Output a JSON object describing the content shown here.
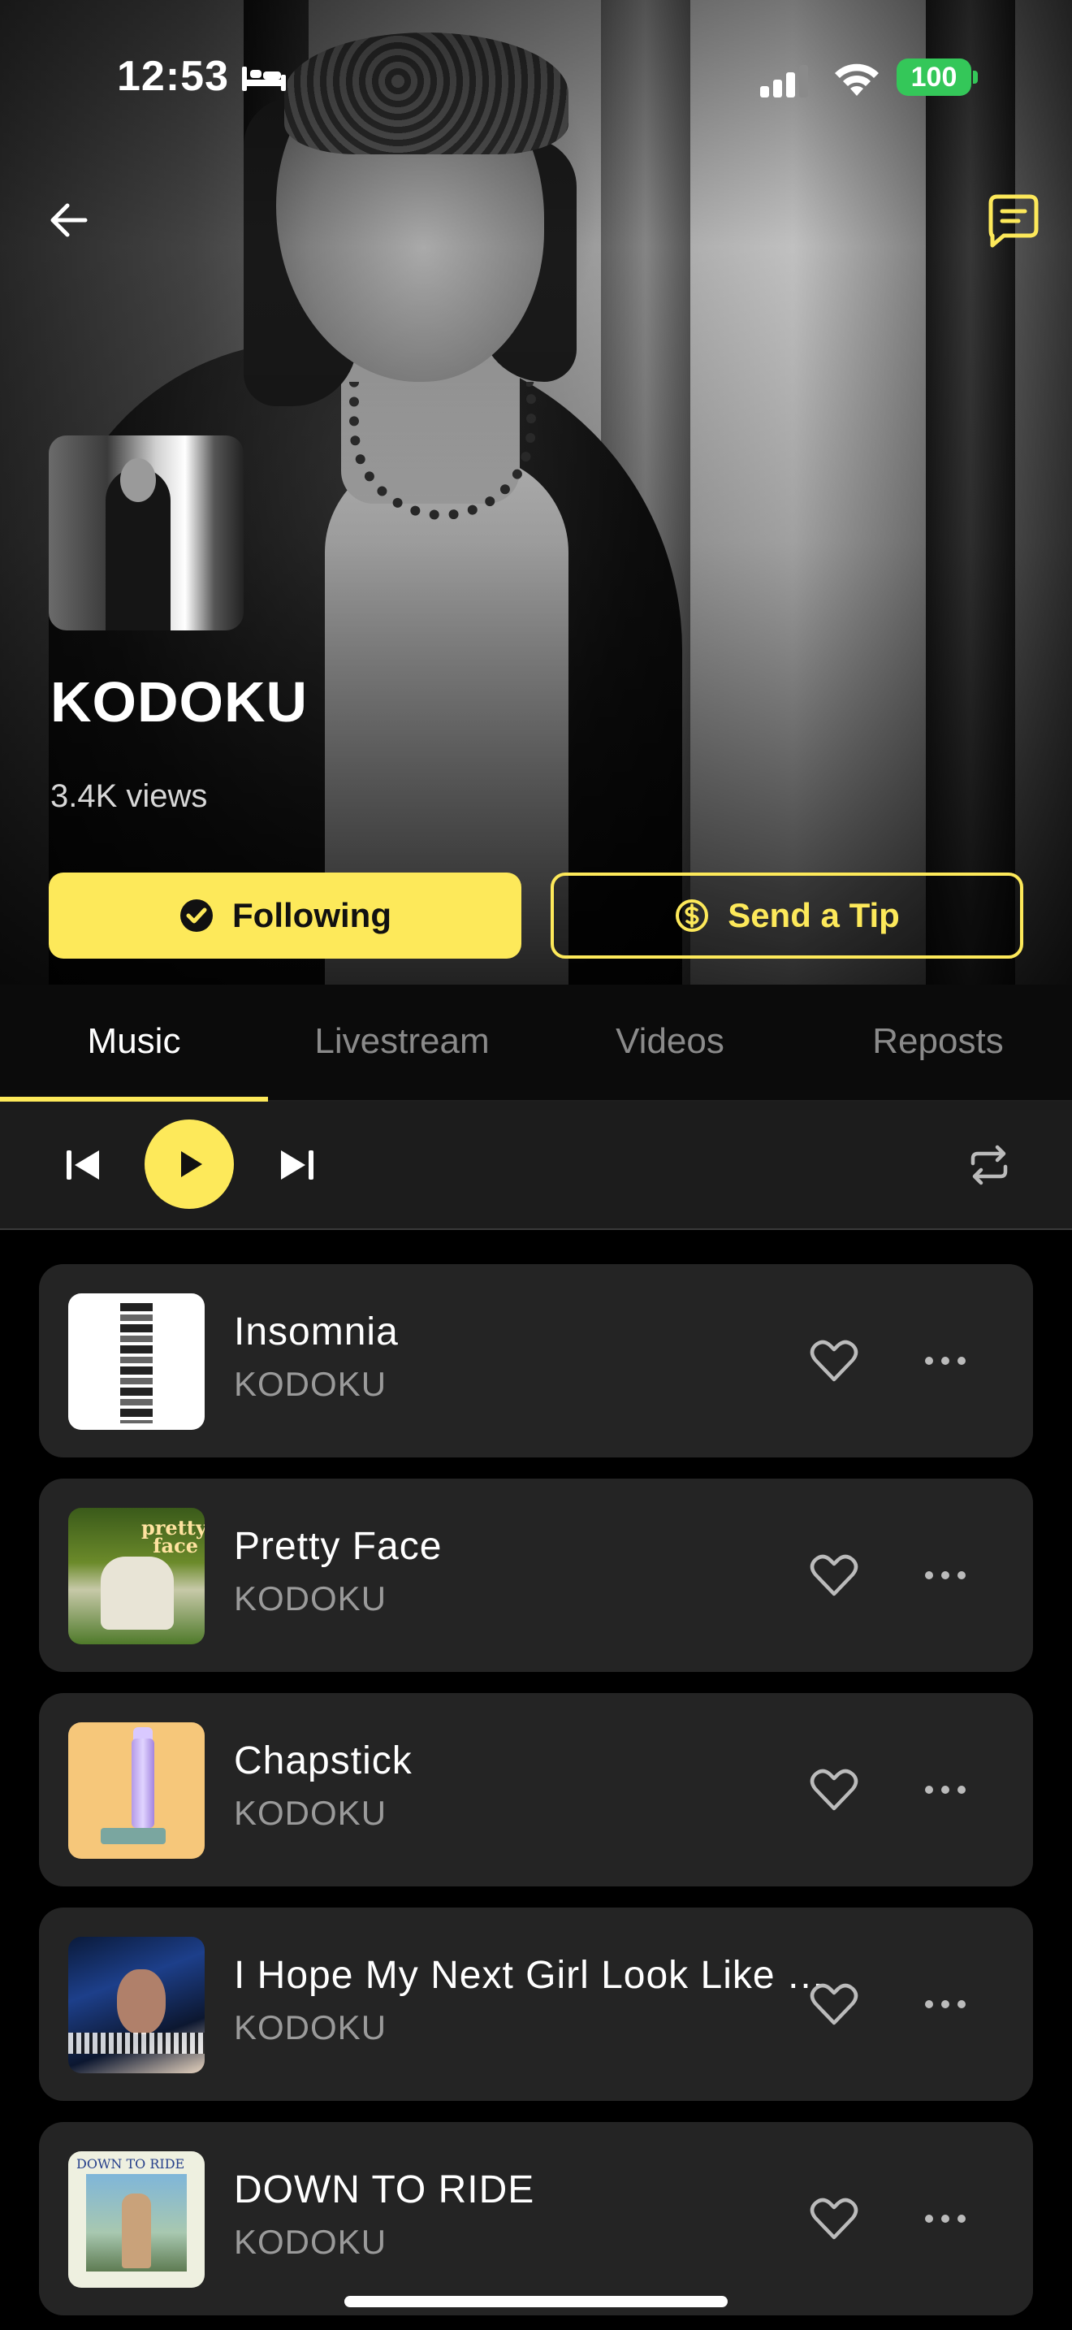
{
  "status_bar": {
    "time": "12:53",
    "battery": "100"
  },
  "header": {
    "back_icon": "arrow-left-icon",
    "chat_icon": "message-square-icon",
    "accent": "#fde95a"
  },
  "artist": {
    "name": "KODOKU",
    "views": "3.4K views",
    "follow_label": "Following",
    "tip_label": "Send a Tip"
  },
  "tabs": [
    {
      "label": "Music",
      "active": true
    },
    {
      "label": "Livestream",
      "active": false
    },
    {
      "label": "Videos",
      "active": false
    },
    {
      "label": "Reposts",
      "active": false
    }
  ],
  "player": {
    "prev_icon": "skip-back-icon",
    "play_icon": "play-icon",
    "next_icon": "skip-forward-icon",
    "repeat_icon": "repeat-icon"
  },
  "tracks": [
    {
      "title": "Insomnia",
      "artist": "KODOKU"
    },
    {
      "title": "Pretty Face",
      "artist": "KODOKU"
    },
    {
      "title": "Chapstick",
      "artist": "KODOKU"
    },
    {
      "title": "I Hope My Next Girl Look Like You",
      "artist": "KODOKU"
    },
    {
      "title": "DOWN TO RIDE",
      "artist": "KODOKU"
    }
  ],
  "artwork_text": {
    "pretty_face": "pretty face",
    "down_to_ride": "DOWN TO RIDE"
  }
}
